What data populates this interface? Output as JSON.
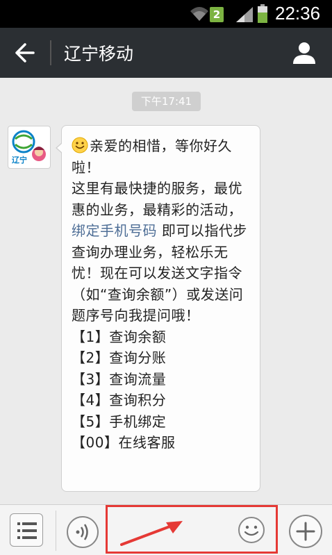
{
  "status_bar": {
    "sim_number": "2",
    "time": "22:36"
  },
  "header": {
    "title": "辽宁移动",
    "back_icon": "arrow-left-icon",
    "profile_icon": "person-icon"
  },
  "chat": {
    "timestamp": "下午17:41",
    "avatar_label": "辽宁",
    "message": {
      "intro": "亲爱的相惜，等你好久啦！",
      "line1": "这里有最快捷的服务，最优惠的业务，最精彩的活动，",
      "link": "绑定手机号码",
      "line2": " 即可以指代步查询办理业务，轻松乐无忧！现在可以发送文字指令（如“查询余额”）或发送问题序号向我提问哦！",
      "options": [
        "【1】查询余额",
        "【2】查询分账",
        "【3】查询流量",
        "【4】查询积分",
        "【5】手机绑定",
        "【00】在线客服"
      ]
    }
  },
  "input_bar": {
    "placeholder": "",
    "value": "",
    "highlight_color": "#e53935"
  },
  "colors": {
    "header_bg": "#2b2f33",
    "chat_bg": "#ebebeb",
    "link": "#4e6e96"
  }
}
